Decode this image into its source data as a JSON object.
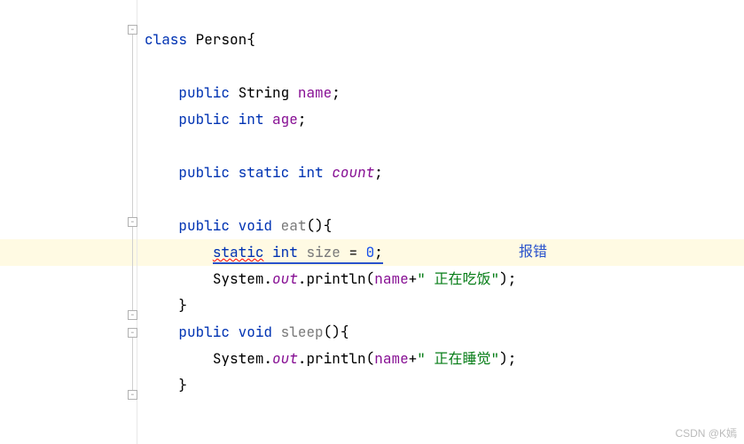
{
  "code": {
    "kw_class": "class",
    "class_name": "Person",
    "brace_open": "{",
    "kw_public": "public",
    "kw_static": "static",
    "kw_void": "void",
    "kw_int": "int",
    "type_string": "String",
    "field_name": "name",
    "field_age": "age",
    "field_count": "count",
    "method_eat": "eat",
    "method_sleep": "sleep",
    "parens": "()",
    "brace_close": "}",
    "err_static": "static",
    "var_size": "size",
    "eq": " = ",
    "zero": "0",
    "semi": ";",
    "system": "System",
    "dot": ".",
    "out": "out",
    "println": "println",
    "lparen": "(",
    "rparen": ")",
    "name_ref": "name",
    "plus": "+",
    "quote": "\"",
    "space": " ",
    "str_eat": "正在吃饭",
    "str_sleep": "正在睡觉"
  },
  "annotation": {
    "error_label": "报错"
  },
  "watermark": "CSDN @K嫣"
}
